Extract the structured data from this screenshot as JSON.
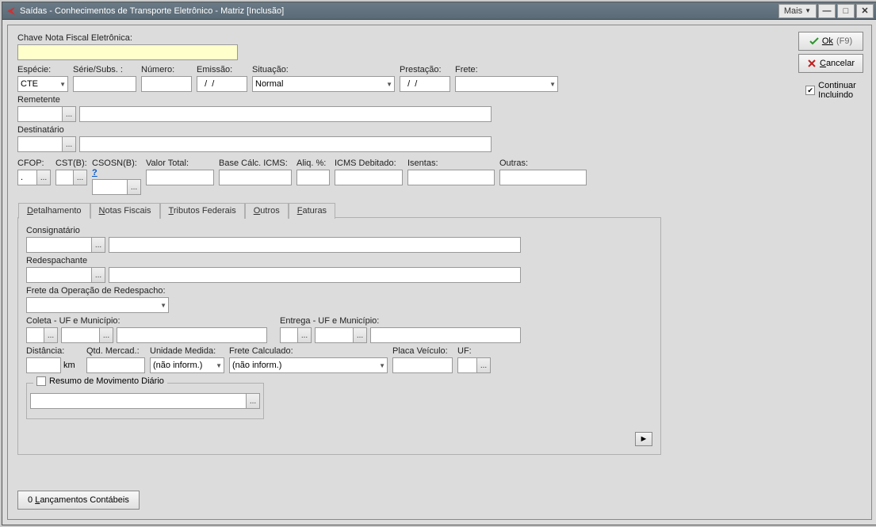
{
  "title": "Saídas - Conhecimentos de Transporte Eletrônico - Matriz [Inclusão]",
  "mais": "Mais",
  "buttons": {
    "ok": "Ok",
    "ok_key": "(F9)",
    "cancel": "Cancelar"
  },
  "continuar": {
    "label": "Continuar",
    "sub": "Incluindo",
    "checked": true
  },
  "main": {
    "chave_label": "Chave Nota Fiscal Eletrônica:",
    "chave_value": "",
    "row2": {
      "especie_l": "Espécie:",
      "especie_v": "CTE",
      "serie_l": "Série/Subs. :",
      "serie_v": "",
      "numero_l": "Número:",
      "numero_v": "",
      "emissao_l": "Emissão:",
      "emissao_v": "  /  /",
      "situacao_l": "Situação:",
      "situacao_v": "Normal",
      "prestacao_l": "Prestação:",
      "prestacao_v": "  /  /",
      "frete_l": "Frete:",
      "frete_v": ""
    },
    "remetente_l": "Remetente",
    "remetente_code": "",
    "remetente_desc": "",
    "destinatario_l": "Destinatário",
    "destinatario_code": "",
    "destinatario_desc": "",
    "row5": {
      "cfop_l": "CFOP:",
      "cfop_v": ".",
      "cstb_l": "CST(B):",
      "csosn_l": "CSOSN(B):",
      "question": "?",
      "valortotal_l": "Valor Total:",
      "basecalc_l": "Base Cálc. ICMS:",
      "aliq_l": "Aliq. %:",
      "icmsdeb_l": "ICMS Debitado:",
      "isentas_l": "Isentas:",
      "outras_l": "Outras:"
    }
  },
  "tabs": {
    "items": [
      "Detalhamento",
      "Notas Fiscais",
      "Tributos Federais",
      "Outros",
      "Faturas"
    ],
    "active": 0,
    "underlines": [
      "D",
      "N",
      "T",
      "O",
      "F"
    ]
  },
  "detail": {
    "consig_l": "Consignatário",
    "redesp_l": "Redespachante",
    "freteop_l": "Frete da Operação de Redespacho:",
    "coleta_l": "Coleta - UF e Município:",
    "entrega_l": "Entrega - UF e Município:",
    "dist_l": "Distância:",
    "dist_unit": "km",
    "qtd_l": "Qtd. Mercad.:",
    "unid_l": "Unidade Medida:",
    "unid_v": "(não inform.)",
    "fretecalc_l": "Frete Calculado:",
    "fretecalc_v": "(não inform.)",
    "placa_l": "Placa Veículo:",
    "uf_l": "UF:",
    "resumo_l": "Resumo de Movimento Diário"
  },
  "footer": {
    "lanc": "0 Lançamentos Contábeis"
  }
}
